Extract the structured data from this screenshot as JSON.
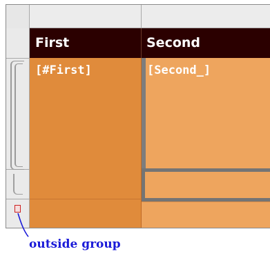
{
  "grid": {
    "columns": [
      {
        "header": "First",
        "field": "[#First]"
      },
      {
        "header": "Second",
        "field": "[Second_]"
      }
    ]
  },
  "callout": {
    "label": "outside group"
  },
  "colors": {
    "header_bg": "#2b0000",
    "detail_dark": "#e08b3b",
    "detail_light": "#eea55e",
    "group_border": "#747474",
    "callout_text": "#1a1ad8",
    "marker": "#cc2020"
  },
  "icons": {
    "row_group_bracket": "group-bracket-icon",
    "outside_marker": "row-marker-icon"
  }
}
